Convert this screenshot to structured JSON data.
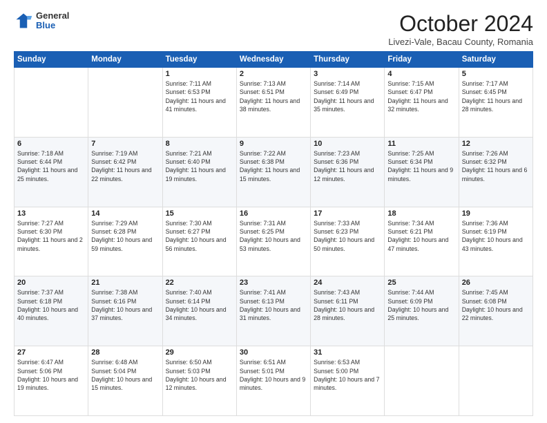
{
  "header": {
    "logo_general": "General",
    "logo_blue": "Blue",
    "month_title": "October 2024",
    "location": "Livezi-Vale, Bacau County, Romania"
  },
  "columns": [
    "Sunday",
    "Monday",
    "Tuesday",
    "Wednesday",
    "Thursday",
    "Friday",
    "Saturday"
  ],
  "rows": [
    [
      {
        "day": "",
        "text": ""
      },
      {
        "day": "",
        "text": ""
      },
      {
        "day": "1",
        "text": "Sunrise: 7:11 AM\nSunset: 6:53 PM\nDaylight: 11 hours and 41 minutes."
      },
      {
        "day": "2",
        "text": "Sunrise: 7:13 AM\nSunset: 6:51 PM\nDaylight: 11 hours and 38 minutes."
      },
      {
        "day": "3",
        "text": "Sunrise: 7:14 AM\nSunset: 6:49 PM\nDaylight: 11 hours and 35 minutes."
      },
      {
        "day": "4",
        "text": "Sunrise: 7:15 AM\nSunset: 6:47 PM\nDaylight: 11 hours and 32 minutes."
      },
      {
        "day": "5",
        "text": "Sunrise: 7:17 AM\nSunset: 6:45 PM\nDaylight: 11 hours and 28 minutes."
      }
    ],
    [
      {
        "day": "6",
        "text": "Sunrise: 7:18 AM\nSunset: 6:44 PM\nDaylight: 11 hours and 25 minutes."
      },
      {
        "day": "7",
        "text": "Sunrise: 7:19 AM\nSunset: 6:42 PM\nDaylight: 11 hours and 22 minutes."
      },
      {
        "day": "8",
        "text": "Sunrise: 7:21 AM\nSunset: 6:40 PM\nDaylight: 11 hours and 19 minutes."
      },
      {
        "day": "9",
        "text": "Sunrise: 7:22 AM\nSunset: 6:38 PM\nDaylight: 11 hours and 15 minutes."
      },
      {
        "day": "10",
        "text": "Sunrise: 7:23 AM\nSunset: 6:36 PM\nDaylight: 11 hours and 12 minutes."
      },
      {
        "day": "11",
        "text": "Sunrise: 7:25 AM\nSunset: 6:34 PM\nDaylight: 11 hours and 9 minutes."
      },
      {
        "day": "12",
        "text": "Sunrise: 7:26 AM\nSunset: 6:32 PM\nDaylight: 11 hours and 6 minutes."
      }
    ],
    [
      {
        "day": "13",
        "text": "Sunrise: 7:27 AM\nSunset: 6:30 PM\nDaylight: 11 hours and 2 minutes."
      },
      {
        "day": "14",
        "text": "Sunrise: 7:29 AM\nSunset: 6:28 PM\nDaylight: 10 hours and 59 minutes."
      },
      {
        "day": "15",
        "text": "Sunrise: 7:30 AM\nSunset: 6:27 PM\nDaylight: 10 hours and 56 minutes."
      },
      {
        "day": "16",
        "text": "Sunrise: 7:31 AM\nSunset: 6:25 PM\nDaylight: 10 hours and 53 minutes."
      },
      {
        "day": "17",
        "text": "Sunrise: 7:33 AM\nSunset: 6:23 PM\nDaylight: 10 hours and 50 minutes."
      },
      {
        "day": "18",
        "text": "Sunrise: 7:34 AM\nSunset: 6:21 PM\nDaylight: 10 hours and 47 minutes."
      },
      {
        "day": "19",
        "text": "Sunrise: 7:36 AM\nSunset: 6:19 PM\nDaylight: 10 hours and 43 minutes."
      }
    ],
    [
      {
        "day": "20",
        "text": "Sunrise: 7:37 AM\nSunset: 6:18 PM\nDaylight: 10 hours and 40 minutes."
      },
      {
        "day": "21",
        "text": "Sunrise: 7:38 AM\nSunset: 6:16 PM\nDaylight: 10 hours and 37 minutes."
      },
      {
        "day": "22",
        "text": "Sunrise: 7:40 AM\nSunset: 6:14 PM\nDaylight: 10 hours and 34 minutes."
      },
      {
        "day": "23",
        "text": "Sunrise: 7:41 AM\nSunset: 6:13 PM\nDaylight: 10 hours and 31 minutes."
      },
      {
        "day": "24",
        "text": "Sunrise: 7:43 AM\nSunset: 6:11 PM\nDaylight: 10 hours and 28 minutes."
      },
      {
        "day": "25",
        "text": "Sunrise: 7:44 AM\nSunset: 6:09 PM\nDaylight: 10 hours and 25 minutes."
      },
      {
        "day": "26",
        "text": "Sunrise: 7:45 AM\nSunset: 6:08 PM\nDaylight: 10 hours and 22 minutes."
      }
    ],
    [
      {
        "day": "27",
        "text": "Sunrise: 6:47 AM\nSunset: 5:06 PM\nDaylight: 10 hours and 19 minutes."
      },
      {
        "day": "28",
        "text": "Sunrise: 6:48 AM\nSunset: 5:04 PM\nDaylight: 10 hours and 15 minutes."
      },
      {
        "day": "29",
        "text": "Sunrise: 6:50 AM\nSunset: 5:03 PM\nDaylight: 10 hours and 12 minutes."
      },
      {
        "day": "30",
        "text": "Sunrise: 6:51 AM\nSunset: 5:01 PM\nDaylight: 10 hours and 9 minutes."
      },
      {
        "day": "31",
        "text": "Sunrise: 6:53 AM\nSunset: 5:00 PM\nDaylight: 10 hours and 7 minutes."
      },
      {
        "day": "",
        "text": ""
      },
      {
        "day": "",
        "text": ""
      }
    ]
  ]
}
